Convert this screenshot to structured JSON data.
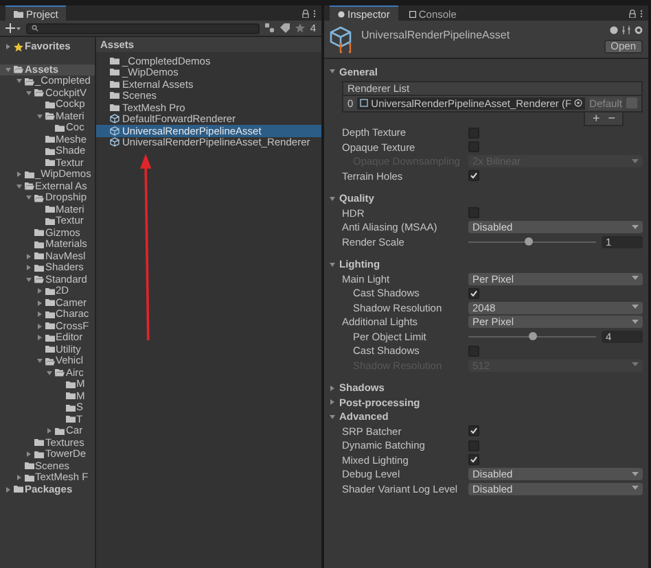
{
  "project": {
    "tab": "Project",
    "hidden_count": "4",
    "favorites": {
      "label": "Favorites",
      "expanded": false
    },
    "tree": [
      {
        "label": "Assets",
        "expanded": true,
        "selected": true,
        "children": [
          {
            "label": "_Completed",
            "expanded": true,
            "selected": false,
            "children": [
              {
                "label": "CockpitV",
                "expanded": true,
                "selected": false,
                "children": [
                  {
                    "label": "Cockp",
                    "selected": false
                  },
                  {
                    "label": "Materi",
                    "expanded": true,
                    "selected": false,
                    "children": [
                      {
                        "label": "Coc",
                        "selected": false
                      }
                    ]
                  },
                  {
                    "label": "Meshe",
                    "selected": false
                  },
                  {
                    "label": "Shade",
                    "selected": false
                  },
                  {
                    "label": "Textur",
                    "selected": false
                  }
                ]
              }
            ]
          },
          {
            "label": "_WipDemos",
            "expanded": false,
            "selected": false
          },
          {
            "label": "External As",
            "expanded": true,
            "selected": false,
            "children": [
              {
                "label": "Dropship",
                "expanded": true,
                "selected": false,
                "children": [
                  {
                    "label": "Materi",
                    "selected": false
                  },
                  {
                    "label": "Textur",
                    "selected": false
                  }
                ]
              },
              {
                "label": "Gizmos",
                "selected": false
              },
              {
                "label": "Materials",
                "selected": false
              },
              {
                "label": "NavMesl",
                "expanded": false,
                "selected": false
              },
              {
                "label": "Shaders",
                "expanded": false,
                "selected": false
              },
              {
                "label": "Standard",
                "expanded": true,
                "selected": false,
                "children": [
                  {
                    "label": "2D",
                    "expanded": false,
                    "selected": false
                  },
                  {
                    "label": "Camer",
                    "expanded": false,
                    "selected": false
                  },
                  {
                    "label": "Charac",
                    "expanded": false,
                    "selected": false
                  },
                  {
                    "label": "CrossF",
                    "expanded": false,
                    "selected": false
                  },
                  {
                    "label": "Editor",
                    "expanded": false,
                    "selected": false
                  },
                  {
                    "label": "Utility",
                    "selected": false
                  },
                  {
                    "label": "Vehicl",
                    "expanded": true,
                    "selected": false,
                    "children": [
                      {
                        "label": "Airc",
                        "expanded": true,
                        "selected": false,
                        "children": [
                          {
                            "label": "M",
                            "selected": false
                          },
                          {
                            "label": "M",
                            "selected": false
                          },
                          {
                            "label": "S",
                            "selected": false
                          },
                          {
                            "label": "T",
                            "selected": false
                          }
                        ]
                      },
                      {
                        "label": "Car",
                        "expanded": false,
                        "selected": false
                      }
                    ]
                  }
                ]
              },
              {
                "label": "Textures",
                "selected": false
              },
              {
                "label": "TowerDe",
                "expanded": false,
                "selected": false
              }
            ]
          },
          {
            "label": "Scenes",
            "selected": false
          },
          {
            "label": "TextMesh F",
            "expanded": false,
            "selected": false
          }
        ]
      },
      {
        "label": "Packages",
        "expanded": false,
        "selected": false
      }
    ],
    "breadcrumb": "Assets",
    "assets": [
      {
        "name": "_CompletedDemos",
        "kind": "folder",
        "selected": false
      },
      {
        "name": "_WipDemos",
        "kind": "folder",
        "selected": false
      },
      {
        "name": "External Assets",
        "kind": "folder",
        "selected": false
      },
      {
        "name": "Scenes",
        "kind": "folder",
        "selected": false
      },
      {
        "name": "TextMesh Pro",
        "kind": "folder",
        "selected": false
      },
      {
        "name": "DefaultForwardRenderer",
        "kind": "asset",
        "selected": false
      },
      {
        "name": "UniversalRenderPipelineAsset",
        "kind": "asset",
        "selected": true
      },
      {
        "name": "UniversalRenderPipelineAsset_Renderer",
        "kind": "asset",
        "selected": false
      }
    ]
  },
  "inspector": {
    "tabs": [
      {
        "label": "Inspector",
        "selected": true
      },
      {
        "label": "Console",
        "selected": false
      }
    ],
    "title": "UniversalRenderPipelineAsset",
    "open_button": "Open",
    "sections": [
      {
        "title": "General",
        "expanded": true,
        "rows": [
          {
            "kind": "list",
            "label": "Renderer List",
            "items": [
              {
                "index": "0",
                "value": "UniversalRenderPipelineAsset_Renderer (F",
                "badge": "Default"
              }
            ],
            "add": "+",
            "remove": "−"
          },
          {
            "kind": "checkbox",
            "label": "Depth Texture",
            "checked": false,
            "disabled": false
          },
          {
            "kind": "checkbox",
            "label": "Opaque Texture",
            "checked": false,
            "disabled": false,
            "children": [
              {
                "kind": "dropdown",
                "label": "Opaque Downsampling",
                "value": "2x Bilinear",
                "disabled": true
              }
            ]
          },
          {
            "kind": "checkbox",
            "label": "Terrain Holes",
            "checked": true,
            "disabled": false
          }
        ]
      },
      {
        "title": "Quality",
        "expanded": true,
        "rows": [
          {
            "kind": "checkbox",
            "label": "HDR",
            "checked": false,
            "disabled": false
          },
          {
            "kind": "dropdown",
            "label": "Anti Aliasing (MSAA)",
            "value": "Disabled",
            "disabled": false
          },
          {
            "kind": "slider",
            "label": "Render Scale",
            "level": 0.47,
            "value": "1",
            "disabled": false
          }
        ]
      },
      {
        "title": "Lighting",
        "expanded": true,
        "rows": [
          {
            "kind": "dropdown",
            "label": "Main Light",
            "value": "Per Pixel",
            "disabled": false,
            "children": [
              {
                "kind": "checkbox",
                "label": "Cast Shadows",
                "checked": true,
                "disabled": false
              },
              {
                "kind": "dropdown",
                "label": "Shadow Resolution",
                "value": "2048",
                "disabled": false
              }
            ]
          },
          {
            "kind": "dropdown",
            "label": "Additional Lights",
            "value": "Per Pixel",
            "disabled": false,
            "children": [
              {
                "kind": "slider",
                "label": "Per Object Limit",
                "level": 0.5,
                "value": "4",
                "disabled": false
              },
              {
                "kind": "checkbox",
                "label": "Cast Shadows",
                "checked": false,
                "disabled": false
              },
              {
                "kind": "dropdown",
                "label": "Shadow Resolution",
                "value": "512",
                "disabled": true
              }
            ]
          }
        ]
      },
      {
        "title": "Shadows",
        "expanded": false
      },
      {
        "title": "Post-processing",
        "expanded": false
      },
      {
        "title": "Advanced",
        "expanded": true,
        "rows": [
          {
            "kind": "checkbox",
            "label": "SRP Batcher",
            "checked": true,
            "disabled": false
          },
          {
            "kind": "checkbox",
            "label": "Dynamic Batching",
            "checked": false,
            "disabled": false
          },
          {
            "kind": "checkbox",
            "label": "Mixed Lighting",
            "checked": true,
            "disabled": false
          },
          {
            "kind": "dropdown",
            "label": "Debug Level",
            "value": "Disabled",
            "disabled": false
          },
          {
            "kind": "dropdown",
            "label": "Shader Variant Log Level",
            "value": "Disabled",
            "disabled": false
          }
        ]
      }
    ]
  }
}
